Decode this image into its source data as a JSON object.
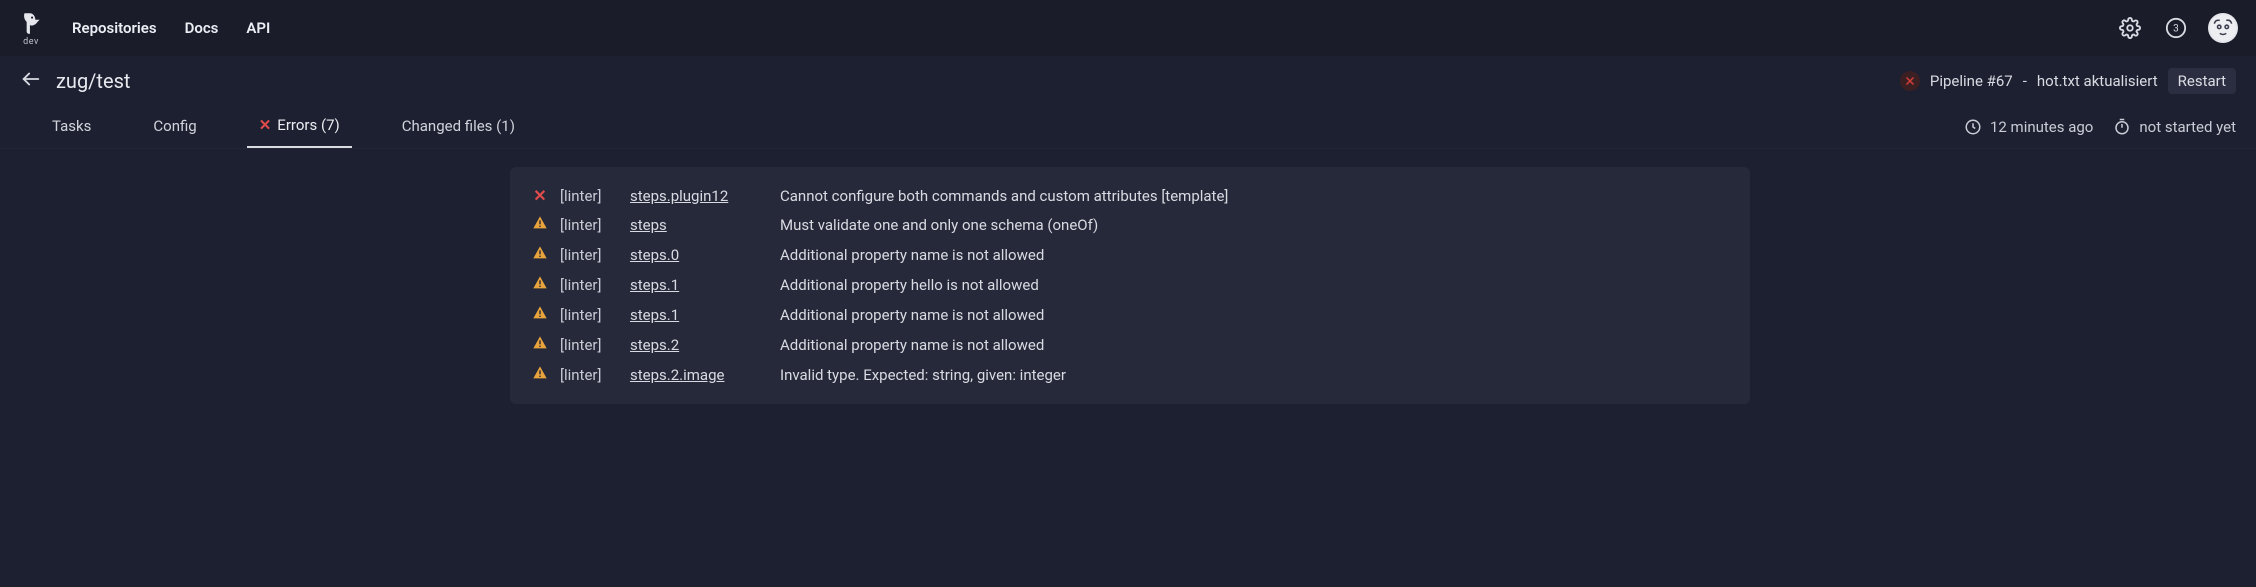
{
  "nav": {
    "logo_sub": "dev",
    "links": [
      "Repositories",
      "Docs",
      "API"
    ]
  },
  "header_icons": {
    "settings": "gear-icon",
    "queue_badge": "3",
    "avatar": "avatar"
  },
  "breadcrumb": {
    "title": "zug/test"
  },
  "pipeline": {
    "status_label": "Pipeline #67",
    "separator": "-",
    "description": "hot.txt aktualisiert",
    "restart_label": "Restart"
  },
  "tabs": {
    "items": [
      {
        "label": "Tasks",
        "active": false
      },
      {
        "label": "Config",
        "active": false
      },
      {
        "label": "Errors (7)",
        "active": true,
        "icon": "x"
      },
      {
        "label": "Changed files (1)",
        "active": false
      }
    ]
  },
  "meta": {
    "time": "12 minutes ago",
    "status": "not started yet"
  },
  "errors": [
    {
      "level": "error",
      "source": "[linter]",
      "path": "steps.plugin12",
      "message": "Cannot configure both commands and custom attributes [template]"
    },
    {
      "level": "warn",
      "source": "[linter]",
      "path": "steps",
      "message": "Must validate one and only one schema (oneOf)"
    },
    {
      "level": "warn",
      "source": "[linter]",
      "path": "steps.0",
      "message": "Additional property name is not allowed"
    },
    {
      "level": "warn",
      "source": "[linter]",
      "path": "steps.1",
      "message": "Additional property hello is not allowed"
    },
    {
      "level": "warn",
      "source": "[linter]",
      "path": "steps.1",
      "message": "Additional property name is not allowed"
    },
    {
      "level": "warn",
      "source": "[linter]",
      "path": "steps.2",
      "message": "Additional property name is not allowed"
    },
    {
      "level": "warn",
      "source": "[linter]",
      "path": "steps.2.image",
      "message": "Invalid type. Expected: string, given: integer"
    }
  ]
}
